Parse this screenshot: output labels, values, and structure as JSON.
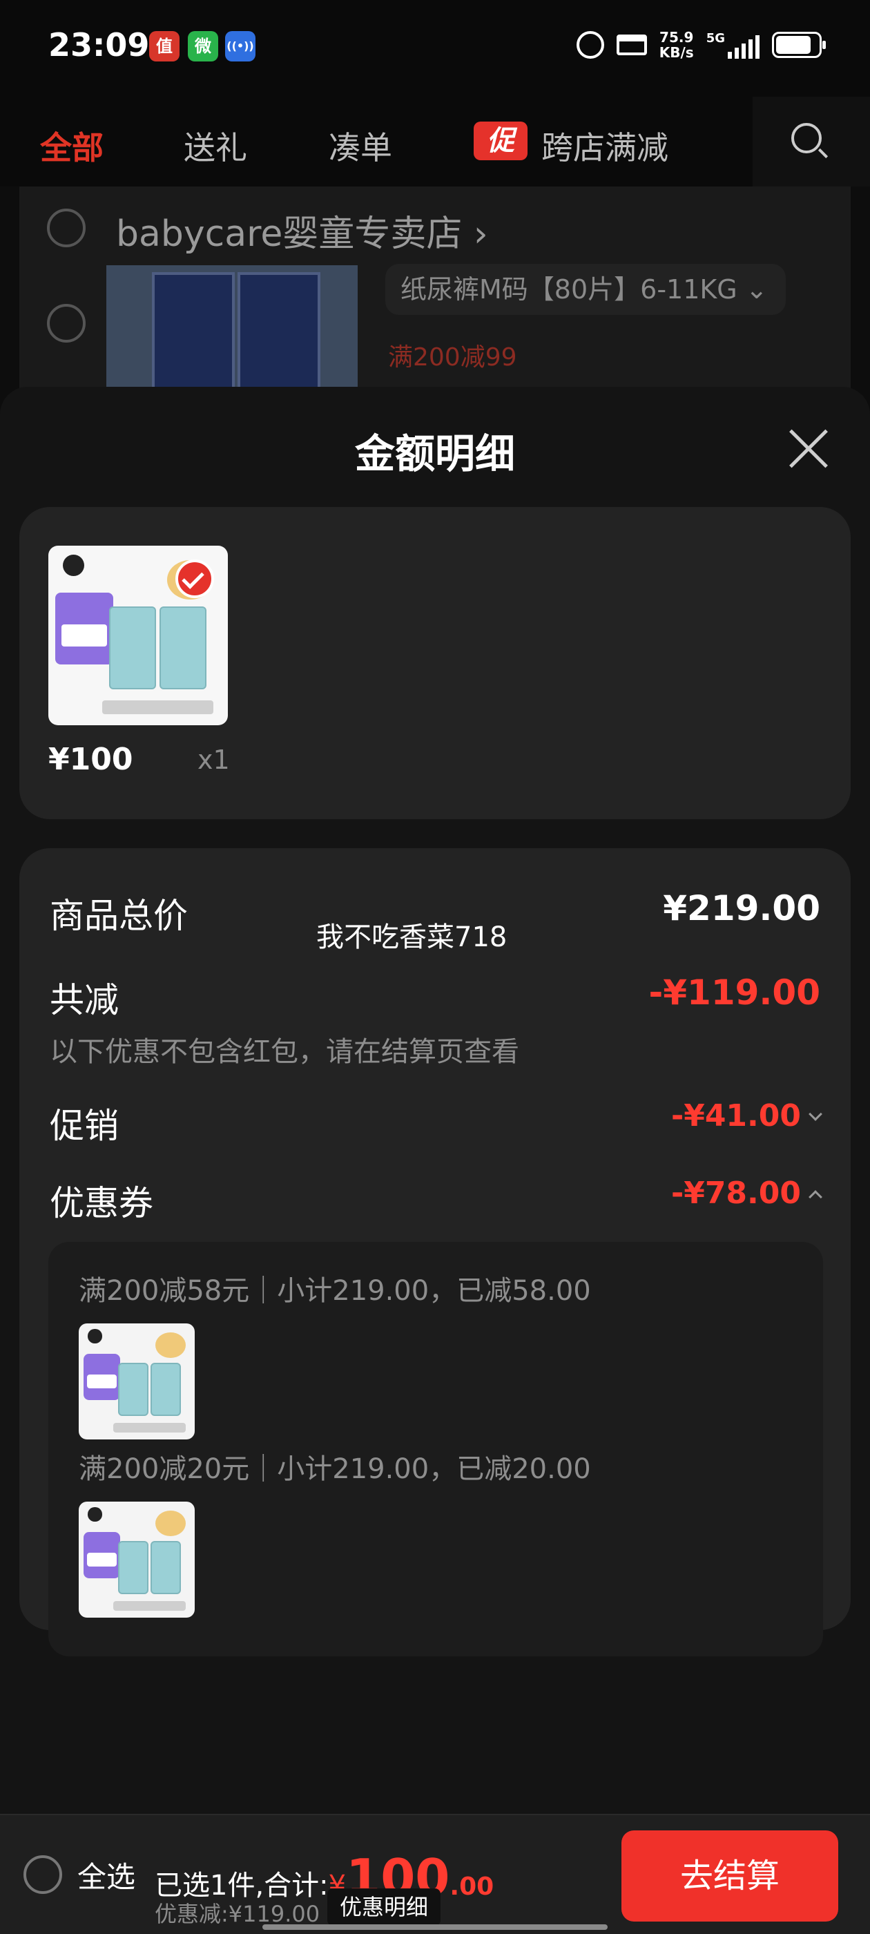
{
  "status": {
    "time": "23:09",
    "net_speed": "75.9",
    "net_unit": "KB/s",
    "signal": "5G",
    "app1": "值",
    "app2": "微",
    "app3": "((•))"
  },
  "tabs": {
    "all": "全部",
    "gift": "送礼",
    "bundle": "凑单",
    "promo_badge": "促",
    "cross_store": "跨店满减"
  },
  "cart_bg": {
    "store": "babycare婴童专卖店 ›",
    "variant": "纸尿裤M码【80片】6-11KG ⌄",
    "promo": "满200减99"
  },
  "sheet": {
    "title": "金额明细",
    "product_price": "¥100",
    "product_qty": "x1",
    "watermark": "我不吃香菜718",
    "total_label": "商品总价",
    "total_value": "¥219.00",
    "reduce_label": "共减",
    "reduce_value": "-¥119.00",
    "reduce_note": "以下优惠不包含红包，请在结算页查看",
    "promo_label": "促销",
    "promo_value": "-¥41.00",
    "coupon_label": "优惠券",
    "coupon_value": "-¥78.00",
    "coupons": [
      {
        "text": "满200减58元｜小计219.00，已减58.00"
      },
      {
        "text": "满200减20元｜小计219.00，已减20.00"
      }
    ]
  },
  "bottom": {
    "select_all": "全选",
    "summary_prefix": "已选1件,合计:",
    "currency": "¥",
    "amount_int": "100",
    "amount_dec": ".00",
    "discount_note": "优惠减:¥119.00",
    "detail_tag": "优惠明细",
    "checkout": "去结算"
  },
  "colors": {
    "accent_red": "#ff3b30",
    "checkout_red": "#f0312a",
    "sheet_bg": "#141414",
    "card_bg": "#232323"
  }
}
